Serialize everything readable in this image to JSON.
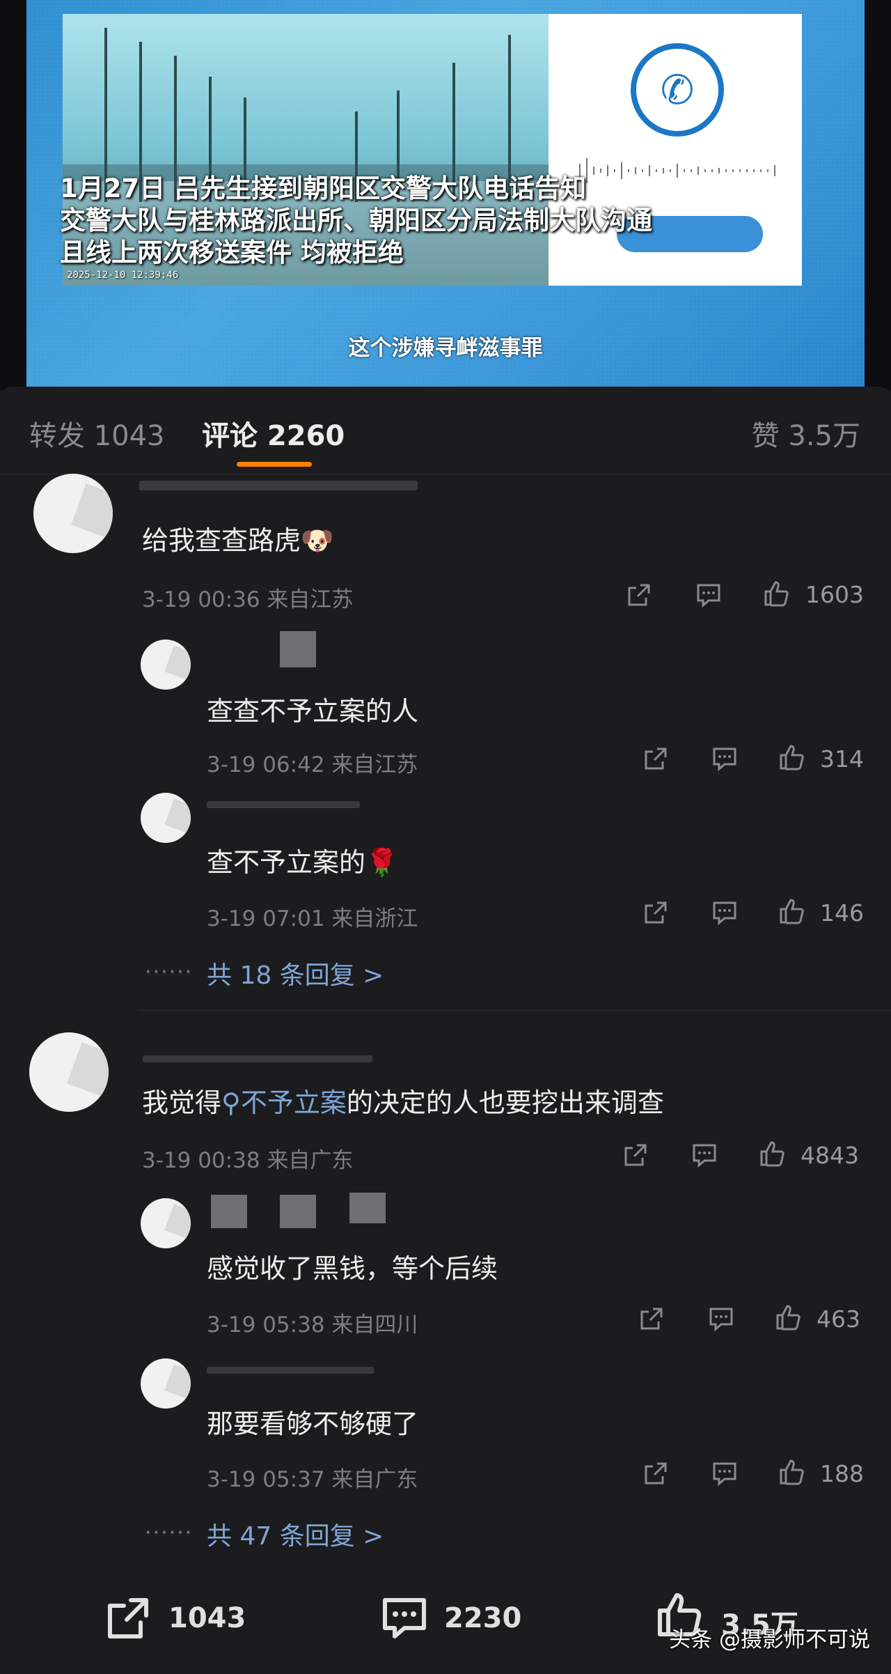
{
  "video": {
    "caption_lines": [
      "1月27日 吕先生接到朝阳区交警大队电话告知",
      "交警大队与桂林路派出所、朝阳区分局法制大队沟通",
      "且线上两次移送案件 均被拒绝"
    ],
    "timestamp": "2025-12-10  12:39:46",
    "subtitle": "这个涉嫌寻衅滋事罪"
  },
  "tabs": {
    "repost": "转发 1043",
    "comments": "评论 2260",
    "likes": "赞 3.5万"
  },
  "comments": [
    {
      "text": "给我查查路虎",
      "emoji": "🐶",
      "meta": "3-19 00:36 来自江苏",
      "likes": "1603",
      "replies": [
        {
          "text": "查查不予立案的人",
          "meta": "3-19 06:42 来自江苏",
          "likes": "314"
        },
        {
          "text": "查不予立案的",
          "emoji": "🌹",
          "meta": "3-19 07:01 来自浙江",
          "likes": "146"
        }
      ],
      "more": "共 18 条回复 >",
      "dots": "······"
    },
    {
      "text_before": "我觉得",
      "search_link": "不予立案",
      "text_after": "的决定的人也要挖出来调查",
      "meta": "3-19 00:38 来自广东",
      "likes": "4843",
      "replies": [
        {
          "text": "感觉收了黑钱，等个后续",
          "meta": "3-19 05:38 来自四川",
          "likes": "463"
        },
        {
          "text": "那要看够不够硬了",
          "meta": "3-19 05:37 来自广东",
          "likes": "188"
        }
      ],
      "more": "共 47 条回复 >",
      "dots": "······"
    }
  ],
  "bottom_bar": {
    "repost_count": "1043",
    "comment_count": "2230",
    "like_count": "3.5万"
  },
  "watermark": "头条 @摄影师不可说",
  "colors": {
    "accent": "#ff8200",
    "link": "#7fa6d6",
    "background": "#1c1c1e"
  }
}
